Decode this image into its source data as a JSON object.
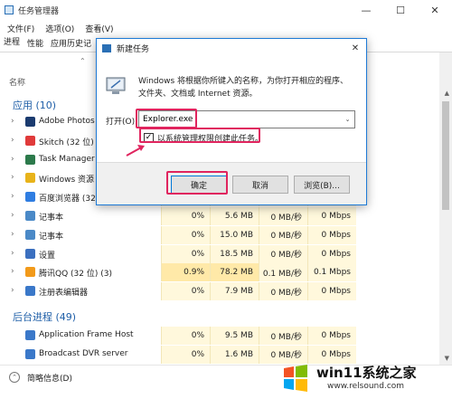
{
  "task_manager": {
    "title": "任务管理器",
    "menu": [
      "文件(F)",
      "选项(O)",
      "查看(V)"
    ],
    "tabs": [
      "进程",
      "性能",
      "应用历史记"
    ],
    "column_name": "名称",
    "apps_group": "应用 (10)",
    "background_group": "后台进程 (49)",
    "apps": [
      {
        "name": "Adobe Photos",
        "cpu": "",
        "mem": "",
        "disk": "",
        "net": "",
        "color": "#1b3b6f"
      },
      {
        "name": "Skitch (32 位)",
        "cpu": "",
        "mem": "",
        "disk": "",
        "net": "",
        "color": "#e03a3a"
      },
      {
        "name": "Task Manager",
        "cpu": "",
        "mem": "",
        "disk": "",
        "net": "",
        "color": "#2c7a4b"
      },
      {
        "name": "Windows 资源",
        "cpu": "",
        "mem": "",
        "disk": "",
        "net": "",
        "color": "#e8b31a"
      },
      {
        "name": "百度浏览器 (32",
        "cpu": "",
        "mem": "",
        "disk": "",
        "net": "",
        "color": "#2f7de1"
      },
      {
        "name": "记事本",
        "cpu": "0%",
        "mem": "5.6 MB",
        "disk": "0 MB/秒",
        "net": "0 Mbps",
        "color": "#4a89c7"
      },
      {
        "name": "记事本",
        "cpu": "0%",
        "mem": "15.0 MB",
        "disk": "0 MB/秒",
        "net": "0 Mbps",
        "color": "#4a89c7"
      },
      {
        "name": "设置",
        "cpu": "0%",
        "mem": "18.5 MB",
        "disk": "0 MB/秒",
        "net": "0 Mbps",
        "color": "#3b6fbf"
      },
      {
        "name": "腾讯QQ (32 位) (3)",
        "cpu": "0.9%",
        "mem": "78.2 MB",
        "disk": "0.1 MB/秒",
        "net": "0.1 Mbps",
        "color": "#f29a1a"
      },
      {
        "name": "注册表编辑器",
        "cpu": "0%",
        "mem": "7.9 MB",
        "disk": "0 MB/秒",
        "net": "0 Mbps",
        "color": "#3a78c9"
      }
    ],
    "background": [
      {
        "name": "Application Frame Host",
        "cpu": "0%",
        "mem": "9.5 MB",
        "disk": "0 MB/秒",
        "net": "0 Mbps",
        "color": "#3a78c9"
      },
      {
        "name": "Broadcast DVR server",
        "cpu": "0%",
        "mem": "1.6 MB",
        "disk": "0 MB/秒",
        "net": "0 Mbps",
        "color": "#3a78c9"
      }
    ],
    "footer_label": "简略信息(D)"
  },
  "dialog": {
    "title": "新建任务",
    "description": "Windows 将根据你所键入的名称，为你打开相应的程序、文件夹、文档或 Internet 资源。",
    "open_label": "打开(O):",
    "open_value": "Explorer.exe",
    "admin_label": "以系统管理权限创建此任务。",
    "ok_label": "确定",
    "cancel_label": "取消",
    "browse_label": "浏览(B)..."
  },
  "watermark": {
    "text": "win11系统之家",
    "sub": "www.relsound.com"
  }
}
